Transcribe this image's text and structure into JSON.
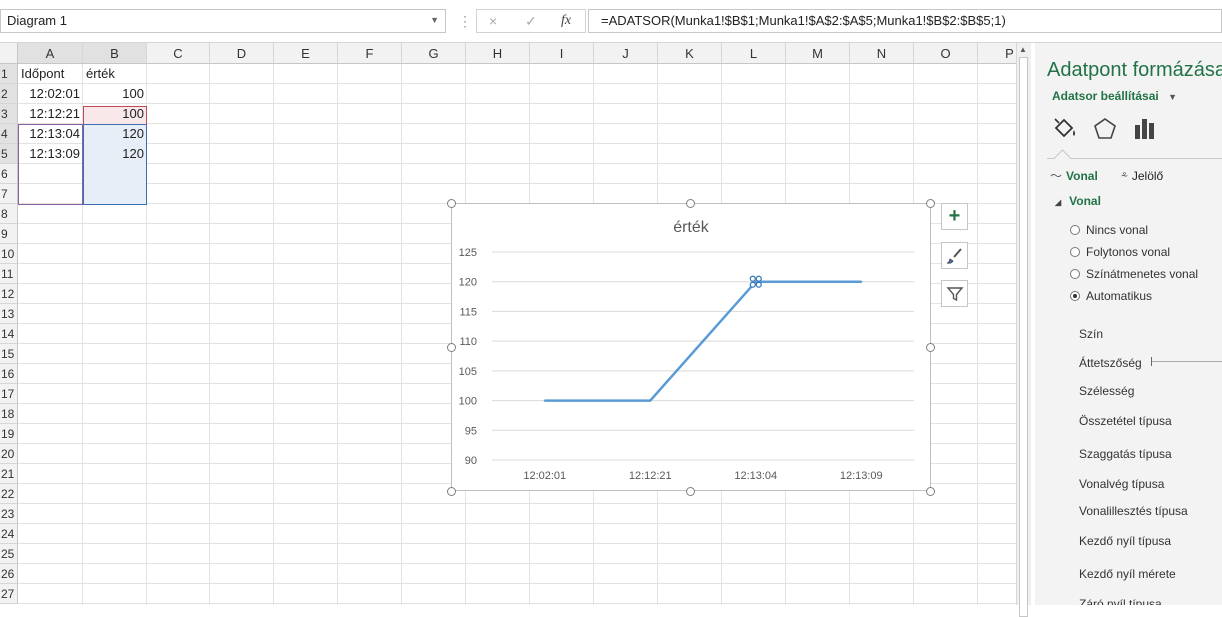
{
  "formula_bar": {
    "name_box": "Diagram 1",
    "cancel_icon": "×",
    "enter_icon": "✓",
    "fx_label": "fx",
    "formula": "=ADATSOR(Munka1!$B$1;Munka1!$A$2:$A$5;Munka1!$B$2:$B$5;1)"
  },
  "sheet": {
    "columns": [
      "A",
      "B",
      "C",
      "D",
      "E",
      "F",
      "G",
      "H",
      "I",
      "J",
      "K",
      "L",
      "M",
      "N",
      "O",
      "P"
    ],
    "rows": [
      "1",
      "2",
      "3",
      "4",
      "5",
      "6",
      "7",
      "8",
      "9",
      "10",
      "11",
      "12",
      "13",
      "14",
      "15",
      "16",
      "17",
      "18",
      "19",
      "20",
      "21",
      "22",
      "23",
      "24",
      "25",
      "26",
      "27"
    ],
    "cells": {
      "A1": "Időpont",
      "B1": "érték",
      "A2": "12:02:01",
      "B2": "100",
      "A3": "12:12:21",
      "B3": "100",
      "A4": "12:13:04",
      "B4": "120",
      "A5": "12:13:09",
      "B5": "120"
    }
  },
  "chart_data": {
    "type": "line",
    "title": "érték",
    "categories": [
      "12:02:01",
      "12:12:21",
      "12:13:04",
      "12:13:09"
    ],
    "series": [
      {
        "values": [
          100,
          100,
          120,
          120
        ],
        "color": "#5b9bd5"
      }
    ],
    "y_ticks": [
      "90",
      "95",
      "100",
      "105",
      "110",
      "115",
      "120",
      "125"
    ],
    "ylim": [
      90,
      125
    ],
    "grid": true,
    "xlabel": "",
    "ylabel": ""
  },
  "chart_buttons": {
    "elements": "+",
    "styles_icon": "brush-icon",
    "filter_icon": "filter-icon"
  },
  "pane": {
    "title": "Adatpont formázása",
    "series_options": "Adatsor beállításai",
    "tabs": {
      "fill_line": "paint-bucket-icon",
      "effects": "pentagon-icon",
      "series": "bar-chart-icon"
    },
    "subtabs": {
      "line": "Vonal",
      "marker": "Jelölő"
    },
    "section": "Vonal",
    "radios": [
      {
        "label": "Nincs vonal",
        "checked": false
      },
      {
        "label": "Folytonos vonal",
        "checked": false
      },
      {
        "label": "Színátmenetes vonal",
        "checked": false
      },
      {
        "label": "Automatikus",
        "checked": true
      }
    ],
    "props": [
      "Szín",
      "Áttetszőség",
      "Szélesség",
      "Összetétel típusa",
      "Szaggatás típusa",
      "Vonalvég típusa",
      "Vonalillesztés típusa",
      "Kezdő nyíl típusa",
      "Kezdő nyíl mérete",
      "Záró nyíl típusa"
    ]
  },
  "colors": {
    "accent": "#217346",
    "series": "#5b9bd5"
  }
}
